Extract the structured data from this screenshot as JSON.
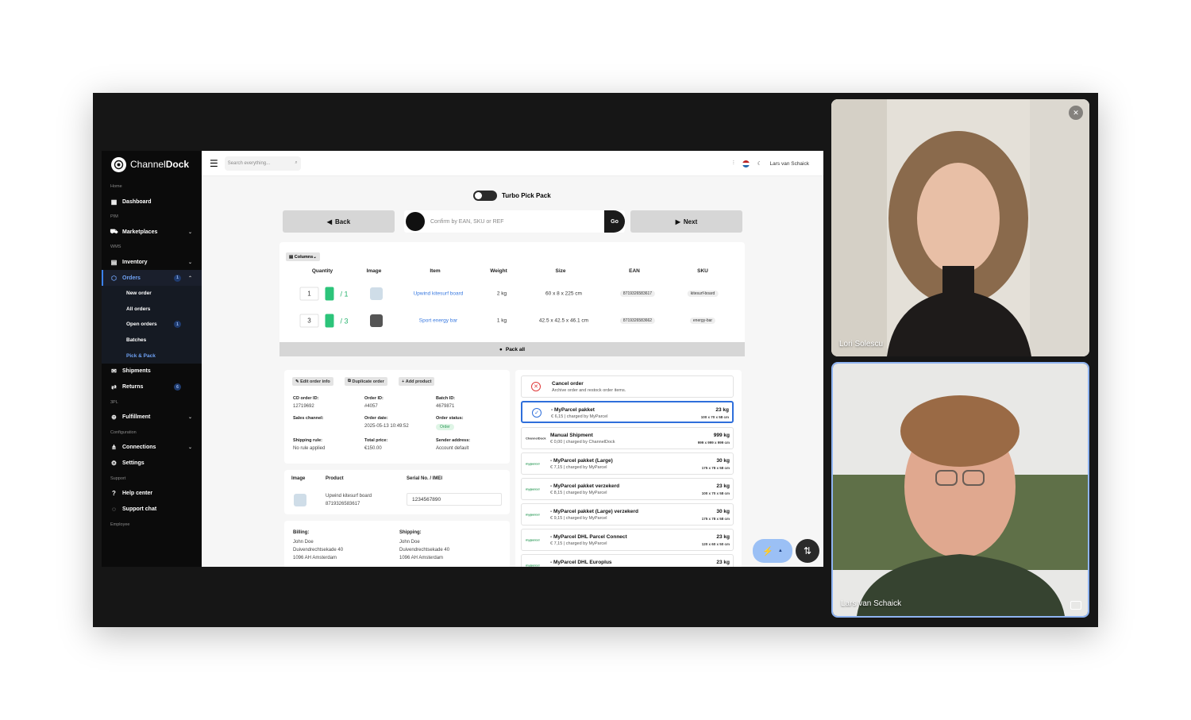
{
  "app": {
    "logo_text_light": "Channel",
    "logo_text_bold": "Dock"
  },
  "sidebar": {
    "sections": {
      "home": "Home",
      "pim": "PIM",
      "wms": "WMS",
      "tpl": "3PL",
      "configuration": "Configuration",
      "support": "Support",
      "employee": "Employee"
    },
    "dashboard": "Dashboard",
    "marketplaces": "Marketplaces",
    "inventory": "Inventory",
    "orders": "Orders",
    "orders_badge": "1",
    "orders_sub": {
      "new_order": "New order",
      "all_orders": "All orders",
      "open_orders": "Open orders",
      "open_orders_badge": "1",
      "batches": "Batches",
      "pick_pack": "Pick & Pack"
    },
    "shipments": "Shipments",
    "returns": "Returns",
    "returns_badge": "6",
    "fulfillment": "Fulfillment",
    "connections": "Connections",
    "settings": "Settings",
    "help_center": "Help center",
    "support_chat": "Support chat"
  },
  "topbar": {
    "search_placeholder": "Search everything...",
    "user_name": "Lars van Schaick"
  },
  "pickpack": {
    "turbo_label": "Turbo Pick Pack",
    "back_label": "Back",
    "confirm_placeholder": "Confirm by EAN, SKU or REF",
    "go_label": "Go",
    "next_label": "Next",
    "columns_label": "Columns",
    "headers": [
      "Quantity",
      "Image",
      "Item",
      "Weight",
      "Size",
      "EAN",
      "SKU"
    ],
    "rows": [
      {
        "qty": "1",
        "total": "/ 1",
        "item": "Upwind kitesurf board",
        "weight": "2 kg",
        "size": "60 x 8 x 225 cm",
        "ean": "8719326583617",
        "sku": "kitesurf-board"
      },
      {
        "qty": "3",
        "total": "/ 3",
        "item": "Sport energy bar",
        "weight": "1 kg",
        "size": "42.5 x 42.5 x 46.1 cm",
        "ean": "8719326583662",
        "sku": "energy-bar"
      }
    ],
    "pack_all_label": "Pack all"
  },
  "order": {
    "edit_label": "Edit order info",
    "duplicate_label": "Duplicate order",
    "add_product_label": "Add product",
    "cd_order_id_label": "CD order ID:",
    "cd_order_id": "12719692",
    "order_id_label": "Order ID:",
    "order_id": "#4057",
    "batch_id_label": "Batch ID:",
    "batch_id": "4679871",
    "sales_channel_label": "Sales channel:",
    "order_date_label": "Order date:",
    "order_date": "2025-05-13 10:49:52",
    "order_status_label": "Order status:",
    "order_status": "Order",
    "shipping_rule_label": "Shipping rule:",
    "shipping_rule": "No rule applied",
    "total_price_label": "Total price:",
    "total_price": "€150.00",
    "sender_address_label": "Sender address:",
    "sender_address": "Account default"
  },
  "serials": {
    "image_header": "Image",
    "product_header": "Product",
    "serial_header": "Serial No. / IMEI",
    "product_name": "Upwind kitesurf board",
    "product_ean": "8719326583617",
    "serial_value": "1234567890"
  },
  "addresses": {
    "billing_label": "Billing:",
    "billing_name": "John Doe",
    "billing_street": "Duivendrechtsekade 40",
    "billing_city": "1096 AH Amsterdam",
    "shipping_label": "Shipping:",
    "shipping_name": "John Doe",
    "shipping_street": "Duivendrechtsekade 40",
    "shipping_city": "1096 AH Amsterdam"
  },
  "shipping_options": {
    "cancel_title": "Cancel order",
    "cancel_desc": "Archive order and restock order items.",
    "options": [
      {
        "carrier": "",
        "name": "- MyParcel pakket",
        "desc": "€ 6,15 | charged by MyParcel",
        "weight": "23 kg",
        "dims": "100 x 70 x 58 cm"
      },
      {
        "carrier": "ChannelDock",
        "name": "Manual Shipment",
        "desc": "€ 0,00 | charged by ChannelDock",
        "weight": "999 kg",
        "dims": "999 x 999 x 999 cm"
      },
      {
        "carrier": "myparcel",
        "name": "- MyParcel pakket (Large)",
        "desc": "€ 7,15 | charged by MyParcel",
        "weight": "30 kg",
        "dims": "175 x 78 x 58 cm"
      },
      {
        "carrier": "myparcel",
        "name": "- MyParcel pakket verzekerd",
        "desc": "€ 8,15 | charged by MyParcel",
        "weight": "23 kg",
        "dims": "100 x 70 x 58 cm"
      },
      {
        "carrier": "myparcel",
        "name": "- MyParcel pakket (Large) verzekerd",
        "desc": "€ 9,15 | charged by MyParcel",
        "weight": "30 kg",
        "dims": "175 x 78 x 58 cm"
      },
      {
        "carrier": "myparcel",
        "name": "- MyParcel DHL Parcel Connect",
        "desc": "€ 7,15 | charged by MyParcel",
        "weight": "23 kg",
        "dims": "120 x 60 x 50 cm"
      },
      {
        "carrier": "myparcel",
        "name": "- MyParcel DHL Europlus",
        "desc": "",
        "weight": "23 kg",
        "dims": ""
      }
    ]
  },
  "video_call": {
    "participant_1": "Lori Solescu",
    "participant_2": "Lars van Schaick"
  },
  "colors": {
    "accent": "#3b82f6",
    "success": "#2cc47a",
    "danger": "#e03a3a"
  }
}
